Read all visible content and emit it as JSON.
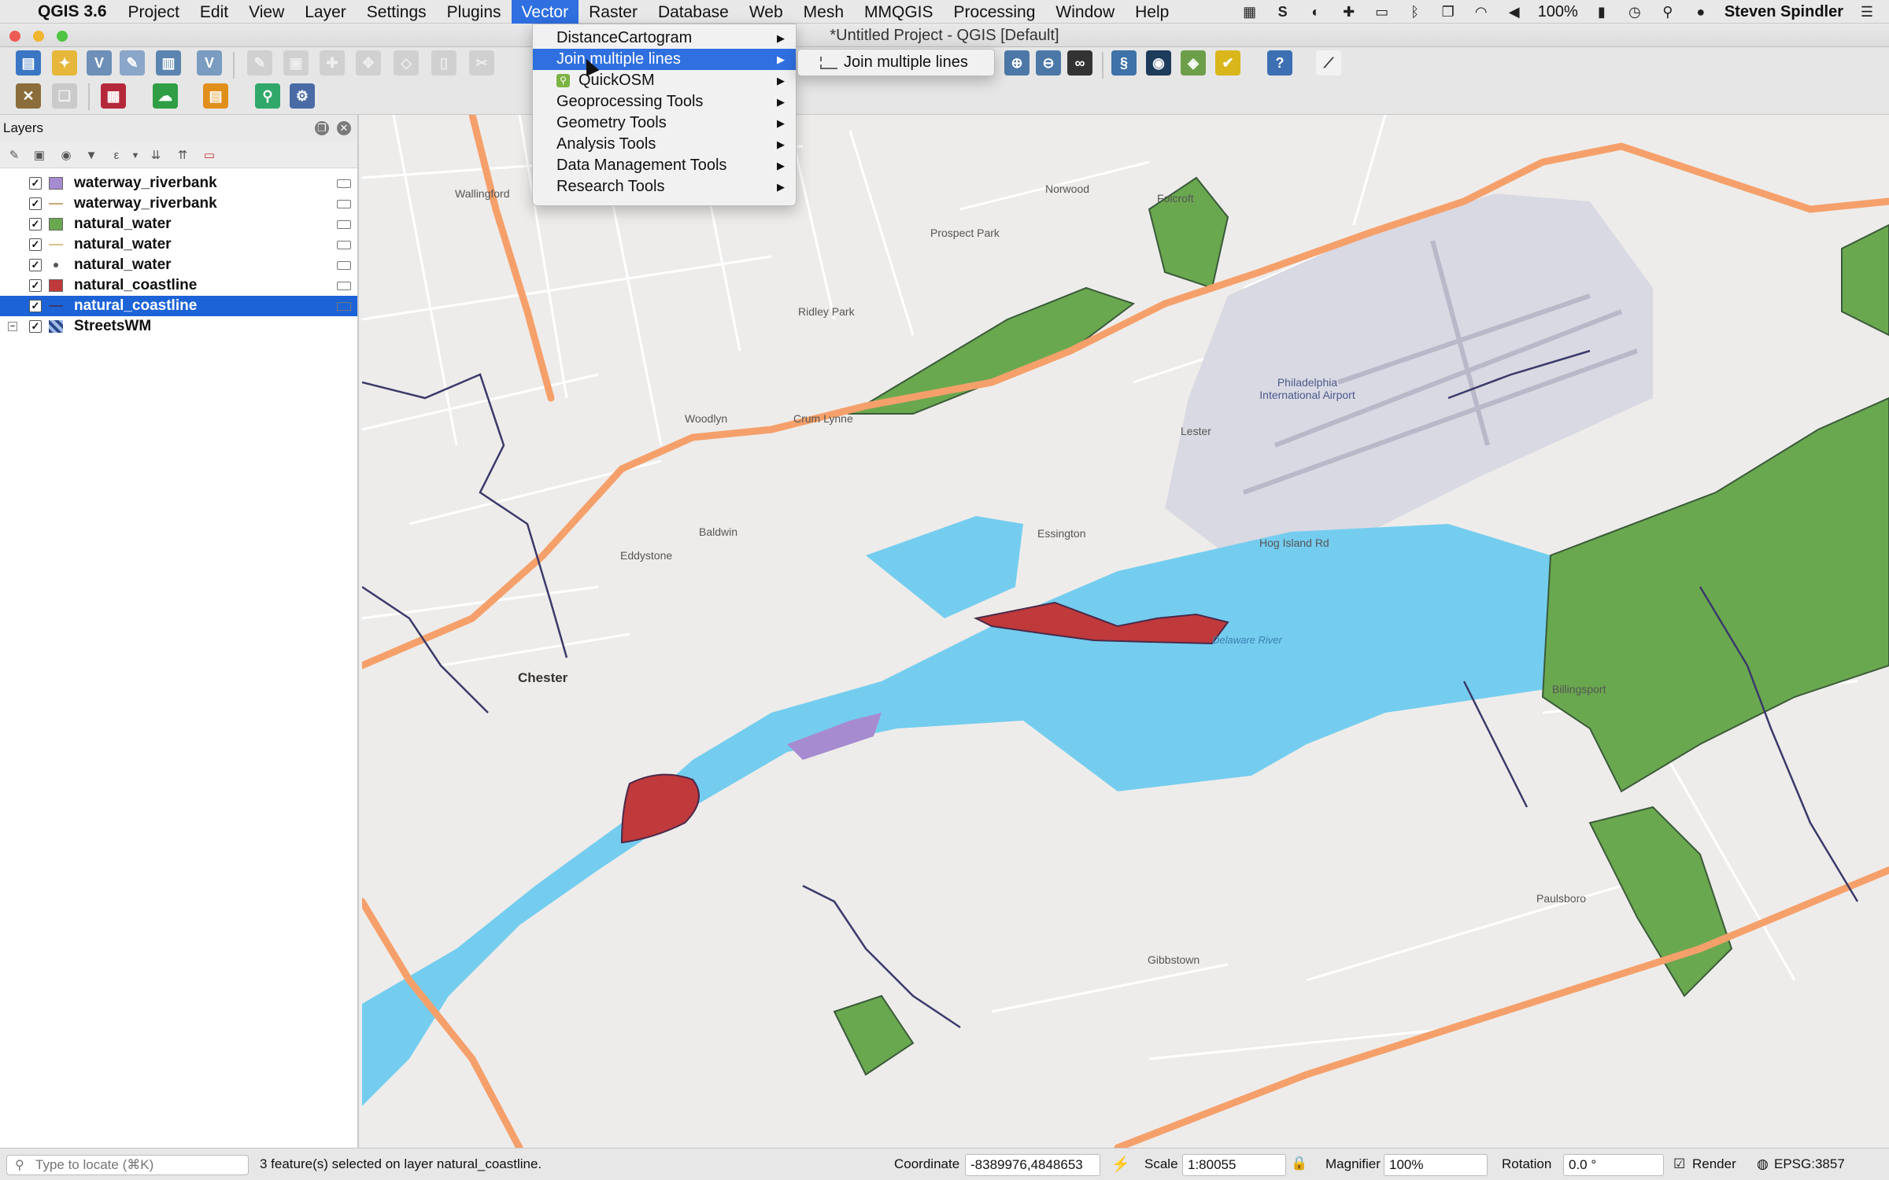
{
  "menubar": {
    "app_name": "QGIS 3.6",
    "items": [
      "Project",
      "Edit",
      "View",
      "Layer",
      "Settings",
      "Plugins",
      "Vector",
      "Raster",
      "Database",
      "Web",
      "Mesh",
      "MMQGIS",
      "Processing",
      "Window",
      "Help"
    ],
    "active_item": "Vector",
    "battery": "100%",
    "user": "Steven Spindler"
  },
  "window": {
    "title": "*Untitled Project - QGIS [Default]"
  },
  "vector_menu": {
    "items": [
      {
        "label": "DistanceCartogram",
        "submenu": true
      },
      {
        "label": "Join multiple lines",
        "submenu": true,
        "highlighted": true
      },
      {
        "label": "QuickOSM",
        "submenu": true,
        "icon": "quickosm-icon"
      },
      {
        "label": "Geoprocessing Tools",
        "submenu": true
      },
      {
        "label": "Geometry Tools",
        "submenu": true
      },
      {
        "label": "Analysis Tools",
        "submenu": true
      },
      {
        "label": "Data Management Tools",
        "submenu": true
      },
      {
        "label": "Research Tools",
        "submenu": true
      }
    ],
    "submenu_item": "Join multiple lines"
  },
  "layers_panel": {
    "title": "Layers",
    "layers": [
      {
        "name": "waterway_riverbank",
        "symbol": "fill",
        "color": "#a78bd1",
        "checked": true
      },
      {
        "name": "waterway_riverbank",
        "symbol": "line",
        "color": "#c9a978",
        "checked": true
      },
      {
        "name": "natural_water",
        "symbol": "fill",
        "color": "#6aa84f",
        "checked": true
      },
      {
        "name": "natural_water",
        "symbol": "line",
        "color": "#d8c38a",
        "checked": true
      },
      {
        "name": "natural_water",
        "symbol": "point",
        "color": "#555555",
        "checked": true
      },
      {
        "name": "natural_coastline",
        "symbol": "fill",
        "color": "#c0393b",
        "checked": true
      },
      {
        "name": "natural_coastline",
        "symbol": "line",
        "color": "#3a3a6a",
        "checked": true,
        "selected": true
      },
      {
        "name": "StreetsWM",
        "symbol": "tiles",
        "color": "#2a4a8a",
        "checked": true,
        "group": true
      }
    ]
  },
  "map": {
    "labels": [
      {
        "text": "Chester",
        "big": true
      },
      {
        "text": "Prospect Park"
      },
      {
        "text": "Norwood"
      },
      {
        "text": "Folcroft"
      },
      {
        "text": "Ridley Park"
      },
      {
        "text": "Eddystone"
      },
      {
        "text": "Baldwin"
      },
      {
        "text": "Essington"
      },
      {
        "text": "Lester"
      },
      {
        "text": "Philadelphia International Airport"
      },
      {
        "text": "Billingsport"
      },
      {
        "text": "Paulsboro"
      },
      {
        "text": "Gibbstown"
      },
      {
        "text": "Woodlyn"
      },
      {
        "text": "Crum Lynne"
      },
      {
        "text": "Wallingford"
      },
      {
        "text": "Delaware River",
        "water": true
      },
      {
        "text": "Hog Island Rd"
      }
    ],
    "colors": {
      "water": "#74cdef",
      "land": "#eeecea",
      "park": "#6aa84f",
      "highway": "#f5a06b",
      "coastline_fill": "#c0393b",
      "riverbank": "#a78bd1"
    }
  },
  "statusbar": {
    "locator_placeholder": "Type to locate (⌘K)",
    "message": "3 feature(s) selected on layer natural_coastline.",
    "coordinate_label": "Coordinate",
    "coordinate_value": "-8389976,4848653",
    "scale_label": "Scale",
    "scale_value": "1:80055",
    "magnifier_label": "Magnifier",
    "magnifier_value": "100%",
    "rotation_label": "Rotation",
    "rotation_value": "0.0 °",
    "render_label": "Render",
    "crs": "EPSG:3857"
  }
}
